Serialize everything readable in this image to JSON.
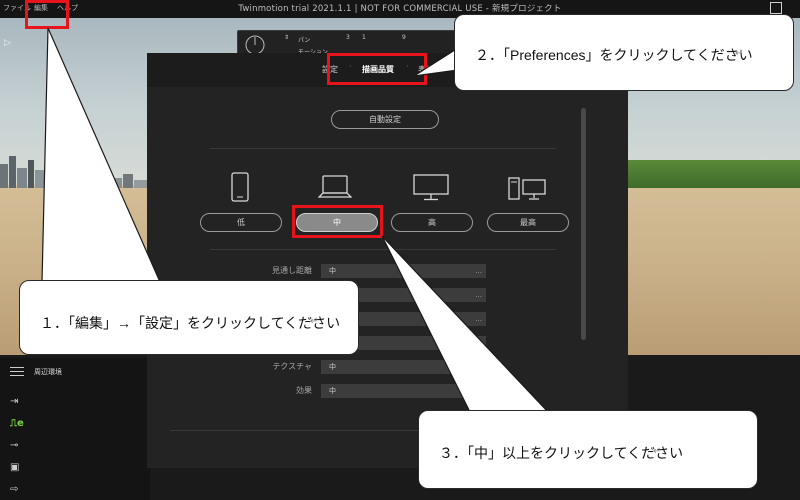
{
  "window": {
    "title": "Twinmotion trial 2021.1.1 | NOT FOR COMMERCIAL USE - 新規プロジェクト",
    "menu": [
      "ファイル",
      "編集",
      "ヘルプ"
    ]
  },
  "toolbar": {
    "pan_label": "パン",
    "mode_label": "モーション",
    "num1": "3",
    "num2": "1",
    "num3": "9"
  },
  "bottom_panel": {
    "title": "周辺環境"
  },
  "dialog": {
    "tabs": [
      "設定",
      "描画品質",
      "表示"
    ],
    "auto_button": "自動設定",
    "quality_levels": [
      {
        "label": "低",
        "icon": "smartphone-icon"
      },
      {
        "label": "中",
        "icon": "laptop-icon",
        "selected": true
      },
      {
        "label": "高",
        "icon": "monitor-icon"
      },
      {
        "label": "最高",
        "icon": "desktop-tower-icon"
      }
    ],
    "rows": [
      {
        "label": "見通し距離",
        "value": "中"
      },
      {
        "label": "",
        "value": ""
      },
      {
        "label": "",
        "value": ""
      },
      {
        "label": "",
        "value": ""
      },
      {
        "label": "テクスチャ",
        "value": "中"
      },
      {
        "label": "効果",
        "value": "中"
      }
    ],
    "more": "..."
  },
  "callouts": {
    "step1": "１．「編集」→「設定」をクリックしてください",
    "step2": "２．「Preferences」をクリックしてください",
    "step3": "３．「中」以上をクリックしてください",
    "return_mark": "↵"
  },
  "colors": {
    "highlight": "#e8141c",
    "selected_button": "#8a8a8a",
    "terrain_icon": "#7fd64a"
  }
}
